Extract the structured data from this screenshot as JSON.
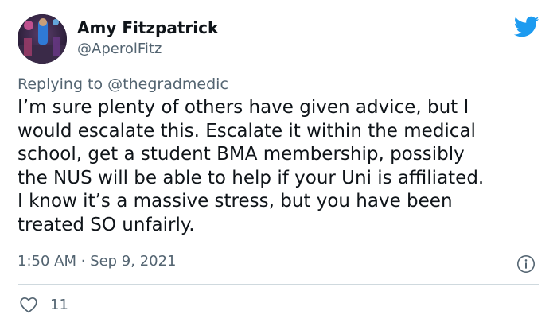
{
  "author": {
    "display_name": "Amy Fitzpatrick",
    "handle": "@AperolFitz",
    "avatar_icon": "profile-photo"
  },
  "reply": {
    "prefix": "Replying to ",
    "mention": "@thegradmedic"
  },
  "tweet": {
    "lines": [
      "I’m sure plenty of others have given advice, but I",
      "would escalate this. Escalate it within the medical",
      "school, get a student BMA membership, possibly",
      "the NUS will be able to help if your Uni is affiliated.",
      "I know it’s a massive stress, but you have been",
      "treated SO unfairly."
    ]
  },
  "meta": {
    "timestamp": "1:50 AM · Sep 9, 2021"
  },
  "actions": {
    "like_icon": "heart-icon",
    "like_count": "11"
  },
  "brand": {
    "logo_icon": "twitter-bird-icon",
    "accent_color": "#1d9bf0",
    "secondary_text_color": "#536471"
  }
}
